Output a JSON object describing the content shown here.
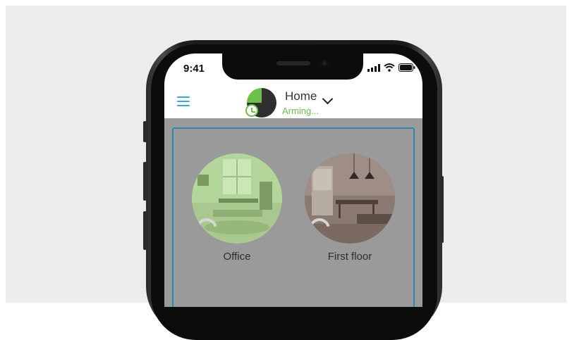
{
  "status_bar": {
    "time": "9:41"
  },
  "header": {
    "hub_name": "Home",
    "hub_status": "Arming..."
  },
  "rooms": [
    {
      "name": "Office"
    },
    {
      "name": "First floor"
    }
  ],
  "colors": {
    "accent_blue": "#35a8d5",
    "arming_green": "#6cc04a",
    "group_border": "#2f86a8",
    "overlay_gray": "#9a9a9a"
  },
  "icons": {
    "menu": "hamburger-menu-icon",
    "dropdown": "chevron-down-icon",
    "timer": "timer-icon",
    "signal": "cellular-signal-icon",
    "wifi": "wifi-icon",
    "battery": "battery-icon",
    "loading": "loading-spinner-icon"
  }
}
